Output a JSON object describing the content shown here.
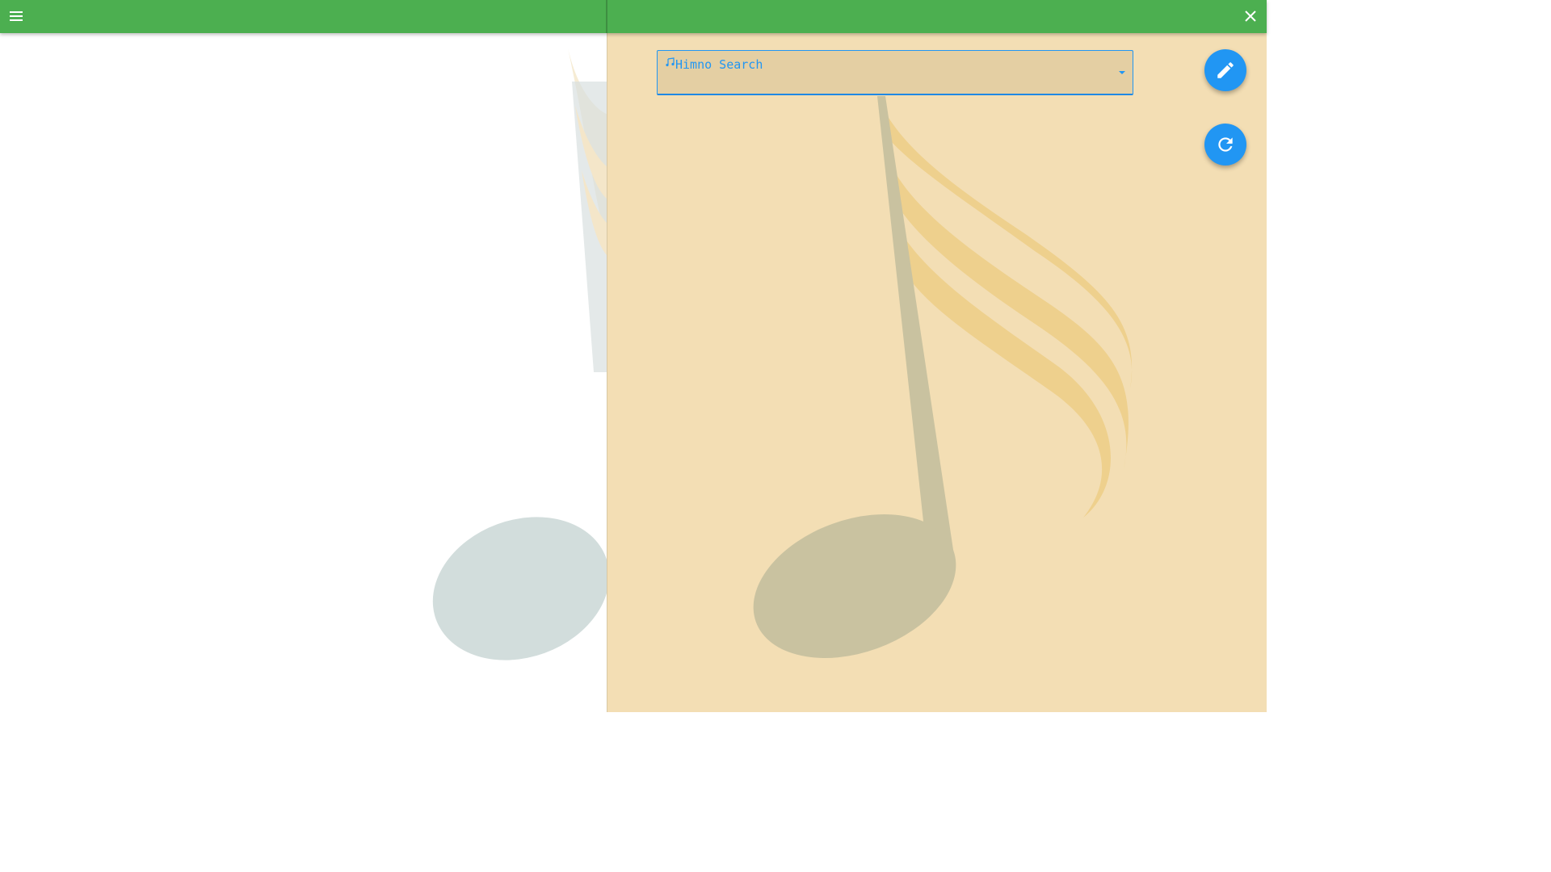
{
  "topbar": {
    "menu_icon": "hamburger-menu-icon",
    "close_icon": "close-icon",
    "color": "#4caf50"
  },
  "search": {
    "label": "Himno Search",
    "label_icon": "music-note-icon",
    "value": "",
    "dropdown_icon": "arrow-drop-down-icon",
    "accent_color": "#2196f3"
  },
  "actions": {
    "edit_icon": "pencil-icon",
    "refresh_icon": "refresh-icon",
    "fab_color": "#2196f3"
  },
  "background": {
    "right_pane_color": "#f3deb4",
    "watermark_icon": "music-note-watermark"
  }
}
